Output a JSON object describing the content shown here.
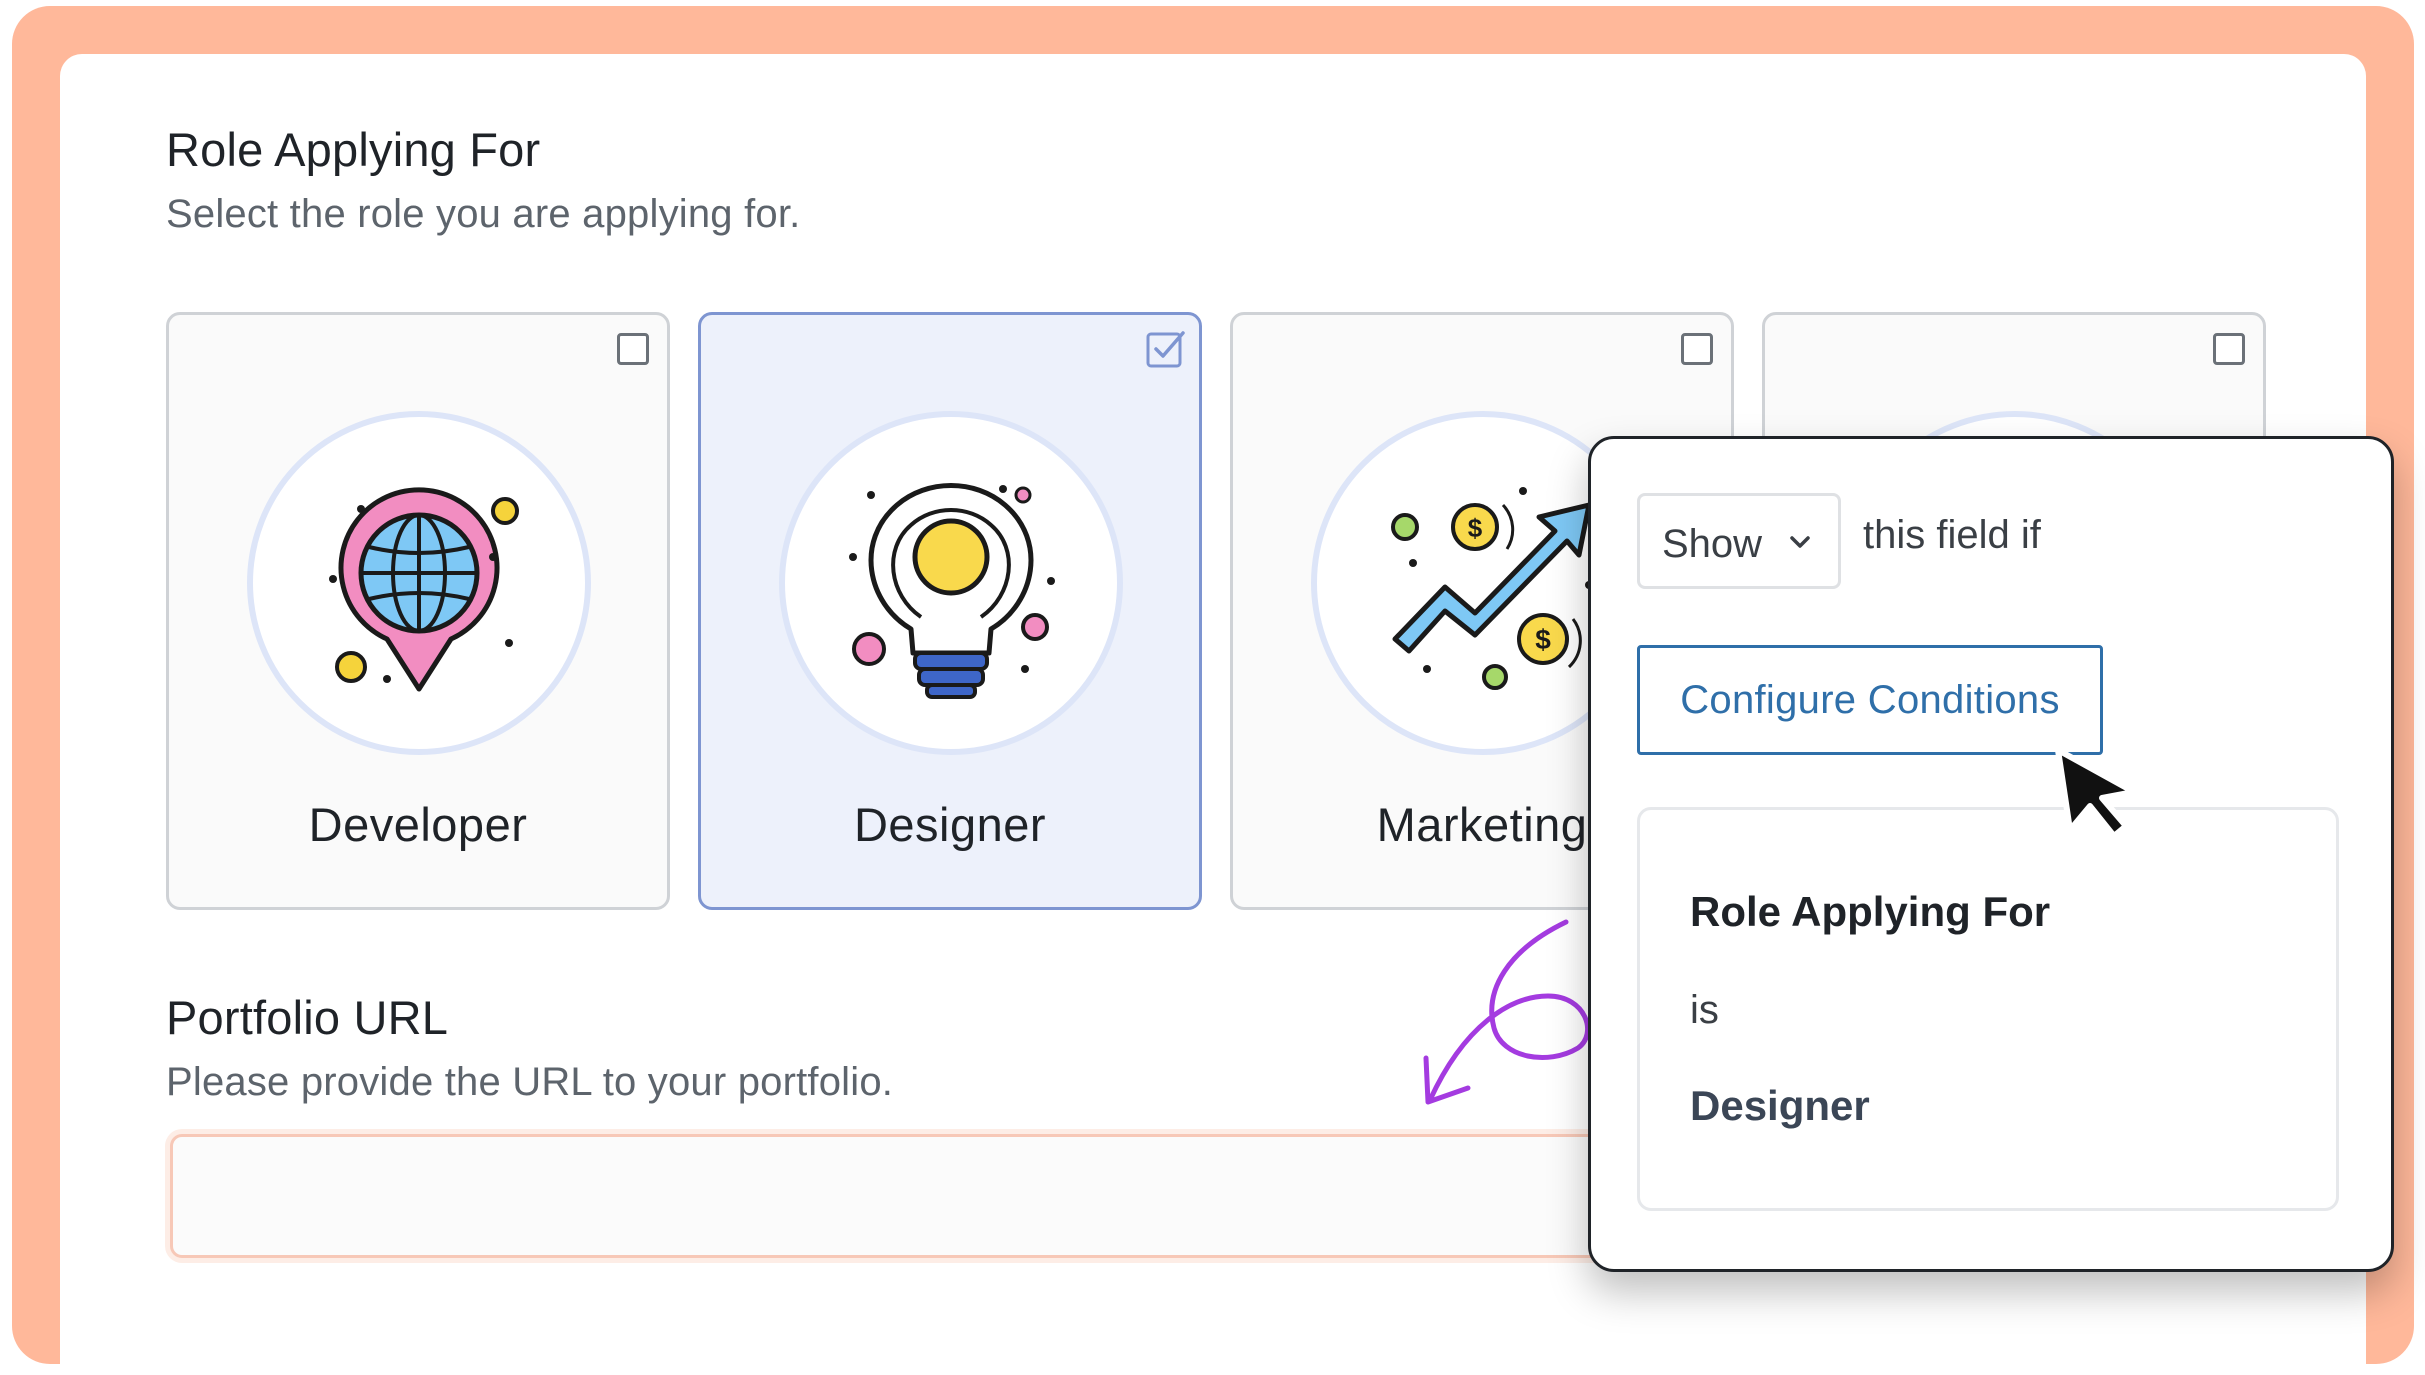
{
  "colors": {
    "frame": "#FFB89A",
    "selected_card_bg": "#EDF1FB",
    "selected_border": "#7E95D1",
    "button_blue": "#2F6FA9",
    "arrow_purple": "#A43BE0"
  },
  "role_field": {
    "title": "Role Applying For",
    "description": "Select the role you are applying for.",
    "options": [
      {
        "label": "Developer",
        "checked": false,
        "icon": "globe-location-pin-icon"
      },
      {
        "label": "Designer",
        "checked": true,
        "icon": "lightbulb-icon"
      },
      {
        "label": "Marketing",
        "checked": false,
        "icon": "growth-chart-dollar-icon"
      },
      {
        "label": "",
        "checked": false,
        "icon": "monitor-icon"
      }
    ]
  },
  "portfolio_field": {
    "title": "Portfolio URL",
    "description": "Please provide the URL to your portfolio.",
    "value": ""
  },
  "conditions_popup": {
    "action_select": "Show",
    "suffix": "this field if",
    "configure_button": "Configure Conditions",
    "condition": {
      "field": "Role Applying For",
      "operator": "is",
      "value": "Designer"
    }
  }
}
